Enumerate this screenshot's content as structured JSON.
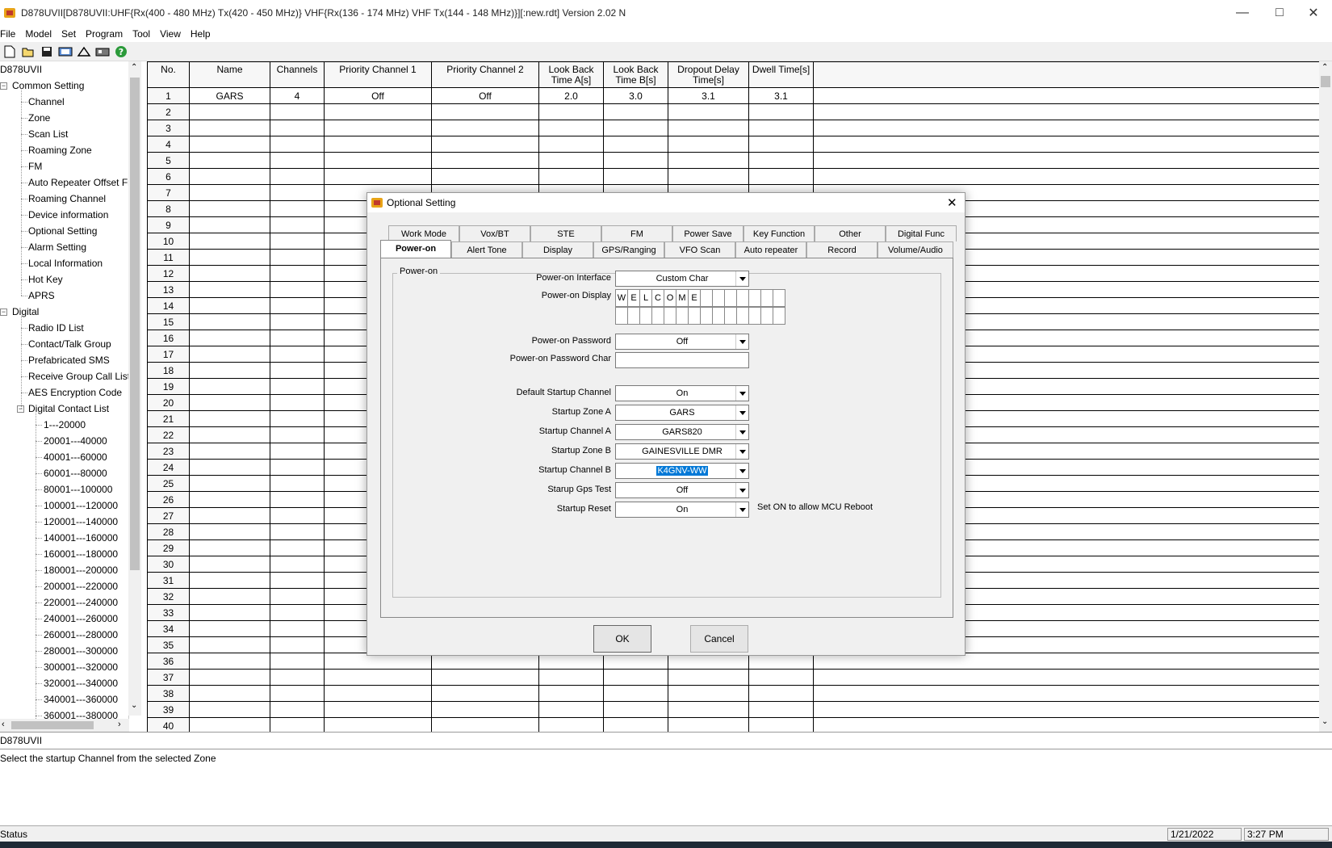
{
  "window": {
    "title": "D878UVII[D878UVII:UHF{Rx(400 - 480 MHz) Tx(420 - 450 MHz)} VHF{Rx(136 - 174 MHz) VHF Tx(144 - 148 MHz)}][:new.rdt] Version 2.02 N"
  },
  "menu": [
    "File",
    "Model",
    "Set",
    "Program",
    "Tool",
    "View",
    "Help"
  ],
  "toolbar": [
    "new-icon",
    "open-icon",
    "save-icon",
    "read-icon",
    "write-icon",
    "device-icon",
    "help-icon"
  ],
  "tree": {
    "root": "D878UVII",
    "common": {
      "label": "Common Setting",
      "items": [
        "Channel",
        "Zone",
        "Scan List",
        "Roaming Zone",
        "FM",
        "Auto Repeater Offset Freq",
        "Roaming Channel",
        "Device information",
        "Optional Setting",
        "Alarm Setting",
        "Local Information",
        "Hot Key",
        "APRS"
      ]
    },
    "digital": {
      "label": "Digital",
      "items": [
        "Radio ID List",
        "Contact/Talk Group",
        "Prefabricated SMS",
        "Receive Group Call List",
        "AES Encryption Code"
      ],
      "contact_list": {
        "label": "Digital Contact List",
        "items": [
          "1---20000",
          "20001---40000",
          "40001---60000",
          "60001---80000",
          "80001---100000",
          "100001---120000",
          "120001---140000",
          "140001---160000",
          "160001---180000",
          "180001---200000",
          "200001---220000",
          "220001---240000",
          "240001---260000",
          "260001---280000",
          "280001---300000",
          "300001---320000",
          "320001---340000",
          "340001---360000",
          "360001---380000"
        ]
      }
    }
  },
  "grid": {
    "headers": [
      "No.",
      "Name",
      "Channels",
      "Priority Channel 1",
      "Priority Channel 2",
      "Look Back Time A[s]",
      "Look Back Time B[s]",
      "Dropout Delay Time[s]",
      "Dwell Time[s]"
    ],
    "row1": [
      "1",
      "GARS",
      "4",
      "Off",
      "Off",
      "2.0",
      "3.0",
      "3.1",
      "3.1"
    ],
    "row_count": 40
  },
  "dialog": {
    "title": "Optional Setting",
    "tabs_row1": [
      "Work Mode",
      "Vox/BT",
      "STE",
      "FM",
      "Power Save",
      "Key Function",
      "Other",
      "Digital Func"
    ],
    "tabs_row2": [
      "Power-on",
      "Alert Tone",
      "Display",
      "GPS/Ranging",
      "VFO Scan",
      "Auto repeater",
      "Record",
      "Volume/Audio"
    ],
    "group": "Power-on",
    "fields": {
      "interface": {
        "label": "Power-on Interface",
        "value": "Custom Char"
      },
      "display": {
        "label": "Power-on Display",
        "chars": [
          "W",
          "E",
          "L",
          "C",
          "O",
          "M",
          "E"
        ]
      },
      "password": {
        "label": "Power-on Password",
        "value": "Off"
      },
      "password_char": {
        "label": "Power-on Password Char",
        "value": ""
      },
      "default_startup": {
        "label": "Default Startup Channel",
        "value": "On"
      },
      "zone_a": {
        "label": "Startup Zone A",
        "value": "GARS"
      },
      "channel_a": {
        "label": "Startup Channel A",
        "value": "GARS820"
      },
      "zone_b": {
        "label": "Startup Zone B",
        "value": "GAINESVILLE DMR"
      },
      "channel_b": {
        "label": "Startup Channel B",
        "value": "K4GNV-WW"
      },
      "gps_test": {
        "label": "Starup Gps Test",
        "value": "Off"
      },
      "reset": {
        "label": "Startup Reset",
        "value": "On",
        "note": "Set ON to allow MCU Reboot"
      }
    },
    "ok": "OK",
    "cancel": "Cancel"
  },
  "device_bar": "D878UVII",
  "hint": "Select the startup Channel from the selected Zone",
  "status": {
    "label": "Status",
    "date": "1/21/2022",
    "time": "3:27 PM"
  },
  "colors": {
    "selection": "#0078d7",
    "app_icon": "#e8a317"
  }
}
